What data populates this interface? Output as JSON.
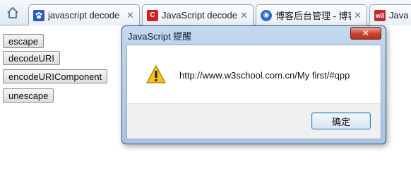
{
  "tabs": [
    {
      "title": "javascript decode",
      "icon": "paw-icon",
      "color": "#2a58c8"
    },
    {
      "title": "JavaScript decode",
      "icon": "c-logo-icon",
      "color": "#cc2222"
    },
    {
      "title": "博客后台管理 - 博客",
      "icon": "blog-icon",
      "color": "#2b6cc4"
    },
    {
      "title": "JavaScr",
      "icon": "w3-icon",
      "color": "#c42a2a"
    }
  ],
  "page": {
    "buttons": [
      "escape",
      "decodeURI",
      "encodeURIComponent",
      "unescape"
    ]
  },
  "dialog": {
    "title": "JavaScript 提醒",
    "message": "http://www.w3school.com.cn/My first/#qpp",
    "ok_label": "确定",
    "close_glyph": "✕",
    "icon": "warning-icon"
  }
}
